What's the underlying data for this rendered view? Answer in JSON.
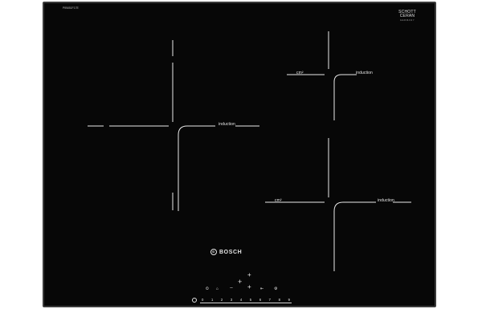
{
  "brand": "BOSCH",
  "model_code": "PIB651F17E",
  "glass_maker": {
    "top": "SCHOTT",
    "bottom": "CERAN",
    "sub": "GERMANY"
  },
  "zones": [
    {
      "id": "left",
      "label": "induction"
    },
    {
      "id": "top-right",
      "label": "induction",
      "left_label": "cm²"
    },
    {
      "id": "bottom-right",
      "label": "induction",
      "left_label": "cm²"
    }
  ],
  "controls": {
    "timer_icon": "timer-icon",
    "lock_icon": "child-lock-icon",
    "zone_select": [
      "+",
      "+",
      "+"
    ],
    "boost_label": "∼",
    "keep_warm_icon": "keep-warm-icon",
    "slider_ticks": [
      "0",
      "1",
      "2",
      "3",
      "4",
      "5",
      "6",
      "7",
      "8",
      "9"
    ],
    "power_icon": "power-icon"
  },
  "colors": {
    "glass": "#070707",
    "frame": "#3a3a3a",
    "print": "#e8e8e8"
  }
}
